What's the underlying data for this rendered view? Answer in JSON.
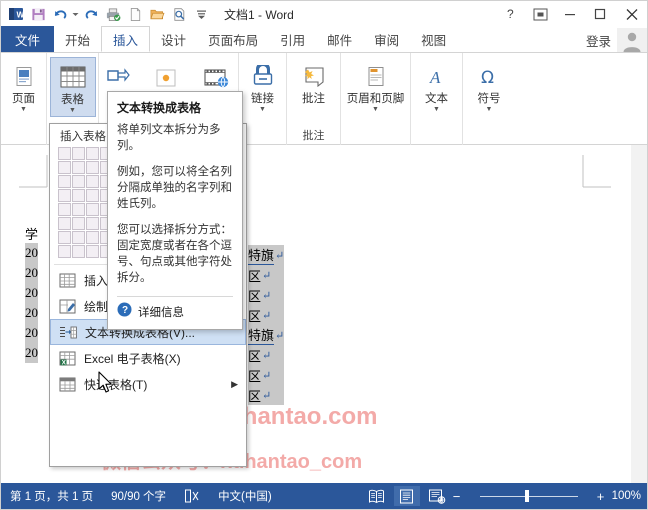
{
  "window": {
    "title": "文档1 - Word",
    "help_icon": "?",
    "ribbon_display_icon": "ribbon-display-options-icon",
    "minimize_icon": "minimize-icon",
    "restore_icon": "restore-icon",
    "close_icon": "close-icon"
  },
  "quick_access": [
    {
      "name": "word-logo-icon",
      "label": "W"
    },
    {
      "name": "save-icon",
      "label": "保存"
    },
    {
      "name": "undo-icon",
      "label": "撤消"
    },
    {
      "name": "redo-icon",
      "label": "恢复"
    },
    {
      "name": "quick-print-icon",
      "label": "快速打印"
    },
    {
      "name": "new-document-icon",
      "label": "新建"
    },
    {
      "name": "open-icon",
      "label": "打开"
    },
    {
      "name": "print-preview-icon",
      "label": "打印预览和打印"
    },
    {
      "name": "customize-qat-icon",
      "label": "自定义快速访问工具栏"
    }
  ],
  "tabs": [
    {
      "label": "文件",
      "type": "file"
    },
    {
      "label": "开始",
      "type": "normal"
    },
    {
      "label": "插入",
      "type": "active"
    },
    {
      "label": "设计",
      "type": "normal"
    },
    {
      "label": "页面布局",
      "type": "normal"
    },
    {
      "label": "引用",
      "type": "normal"
    },
    {
      "label": "邮件",
      "type": "normal"
    },
    {
      "label": "审阅",
      "type": "normal"
    },
    {
      "label": "视图",
      "type": "normal"
    }
  ],
  "account": {
    "signin_label": "登录",
    "avatar_name": "user-avatar"
  },
  "ribbon": {
    "groups": [
      {
        "label": "页面",
        "group_label": ""
      },
      {
        "label": "表格",
        "group_label": ""
      },
      {
        "label": "",
        "group_label": ""
      },
      {
        "label": "链接",
        "group_label": ""
      },
      {
        "label": "批注",
        "group_label": "批注"
      },
      {
        "label": "页眉和页脚",
        "group_label": ""
      },
      {
        "label": "文本",
        "group_label": ""
      },
      {
        "label": "符号",
        "group_label": ""
      }
    ],
    "btn_page": "页面",
    "btn_table": "表格",
    "btn_link": "链接",
    "btn_comment": "批注",
    "btn_header_footer": "页眉和页脚",
    "btn_text": "文本",
    "btn_symbol": "符号",
    "group_comment_label": "批注"
  },
  "table_menu": {
    "title": "插入表格",
    "grid_cols": 10,
    "grid_rows": 8,
    "items": [
      {
        "label": "插入表格(I)...",
        "icon": "insert-table-icon",
        "highlighted": false,
        "submenu": false
      },
      {
        "label": "绘制表格(D)",
        "icon": "draw-table-icon",
        "highlighted": false,
        "submenu": false
      },
      {
        "label": "文本转换成表格(V)...",
        "icon": "text-to-table-icon",
        "highlighted": true,
        "submenu": false
      },
      {
        "label": "Excel 电子表格(X)",
        "icon": "excel-spreadsheet-icon",
        "highlighted": false,
        "submenu": false
      },
      {
        "label": "快速表格(T)",
        "icon": "quick-tables-icon",
        "highlighted": false,
        "submenu": true
      }
    ]
  },
  "tooltip": {
    "title": "文本转换成表格",
    "paragraphs": [
      "将单列文本拆分为多列。",
      "例如，您可以将全名列分隔成单独的名字列和姓氏列。",
      "您可以选择拆分方式：固定宽度或者在各个逗号、句点或其他字符处拆分。"
    ],
    "footer_label": "详细信息",
    "footer_icon": "help-circle-icon"
  },
  "document": {
    "lines": [
      {
        "text": "学",
        "selected": false
      },
      {
        "text": "20",
        "selected": true
      },
      {
        "text": "20",
        "selected": true
      },
      {
        "text": "20",
        "selected": true
      },
      {
        "text": "20",
        "selected": true
      },
      {
        "text": "20",
        "selected": true
      },
      {
        "text": "20",
        "selected": true
      }
    ],
    "right_lines": [
      {
        "text": "特旗",
        "selected": true,
        "underline": true
      },
      {
        "text": "区",
        "selected": true,
        "underline": false
      },
      {
        "text": "区",
        "selected": true,
        "underline": false
      },
      {
        "text": "区",
        "selected": true,
        "underline": false
      },
      {
        "text": "特旗",
        "selected": true,
        "underline": true
      },
      {
        "text": "区",
        "selected": true,
        "underline": false
      },
      {
        "text": "区",
        "selected": true,
        "underline": false
      },
      {
        "text": "区",
        "selected": true,
        "underline": false
      }
    ],
    "watermark_1": "www.xuhantao.com",
    "watermark_2": "微信公众号：xuhantao_com"
  },
  "status": {
    "page_info": "第 1 页，共 1 页",
    "word_count": "90/90 个字",
    "proofing_icon": "proofing-errors-icon",
    "language": "中文(中国)",
    "views": [
      {
        "name": "read-mode-view-icon",
        "active": false
      },
      {
        "name": "print-layout-view-icon",
        "active": true
      },
      {
        "name": "web-layout-view-icon",
        "active": false
      }
    ],
    "zoom_out": "−",
    "zoom_in": "+",
    "zoom_level": "100%"
  },
  "colors": {
    "accent": "#2b579a",
    "ribbon_selected": "#cfdcef",
    "menu_highlight": "#cfe0f4",
    "watermark": "#f3aaa8",
    "selection_gray": "#c8c8c8"
  }
}
